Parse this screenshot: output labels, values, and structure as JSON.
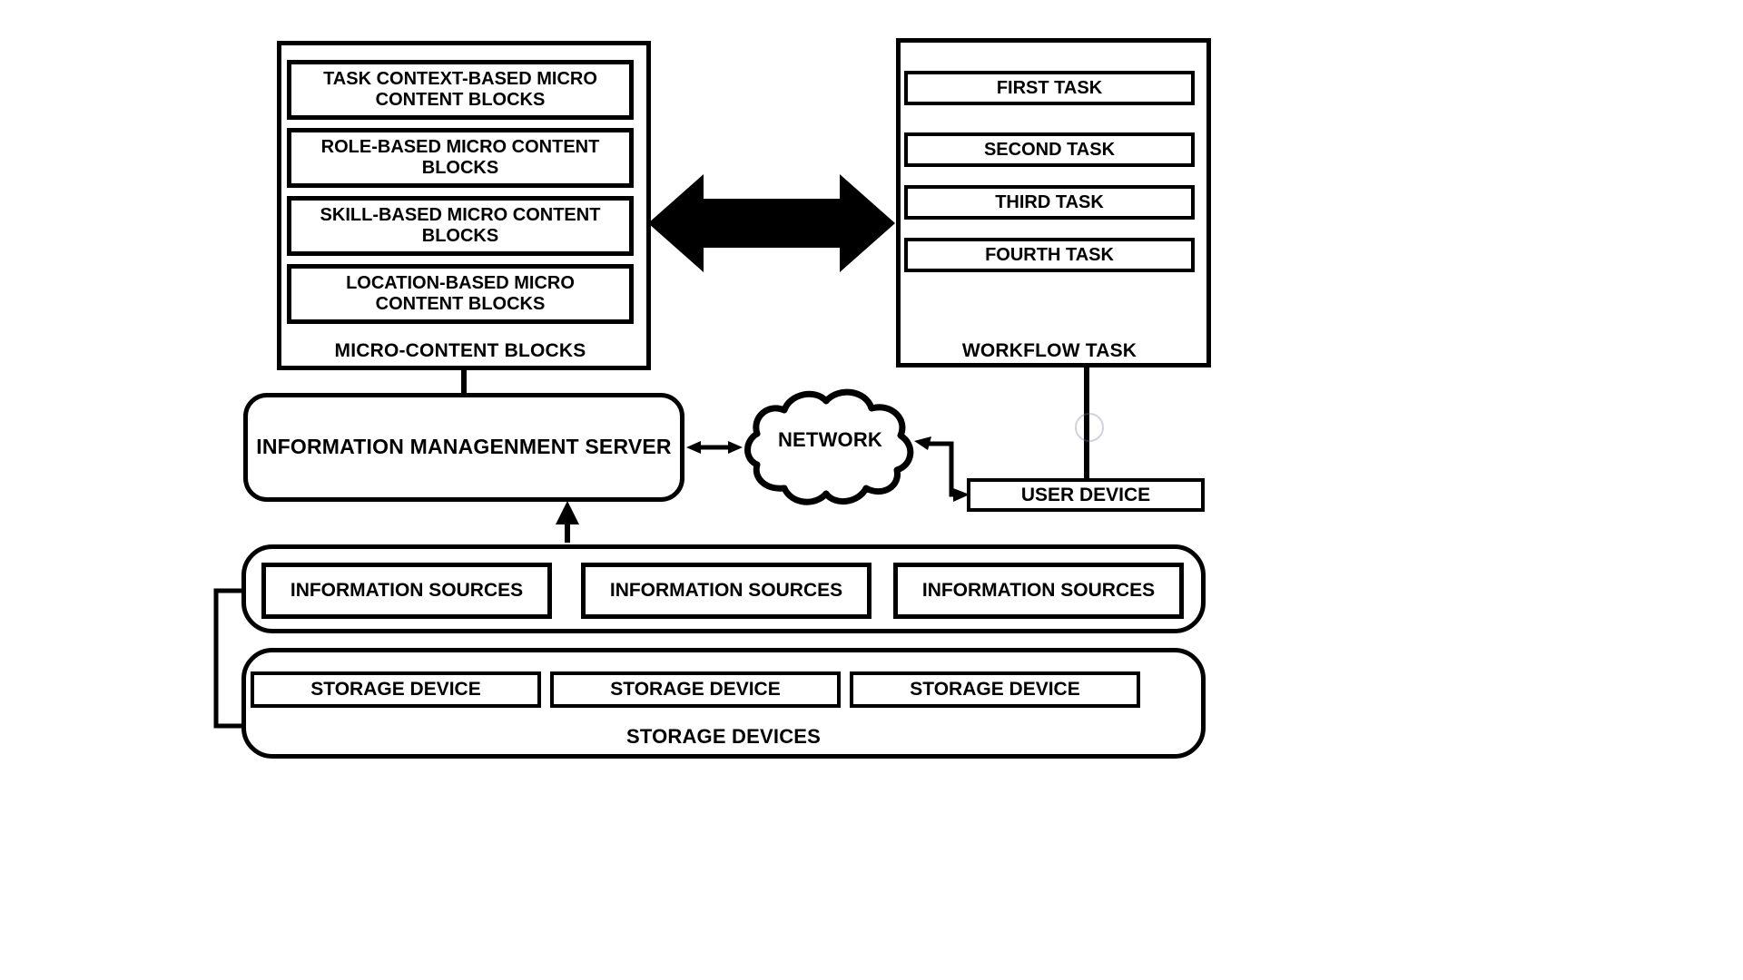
{
  "diagram": {
    "title": "Information management system block diagram",
    "stroke_color": "#000000",
    "background_color": "#ffffff"
  },
  "micro_content_panel": {
    "caption": "MICRO-CONTENT BLOCKS",
    "blocks": [
      {
        "label": "TASK CONTEXT-BASED MICRO CONTENT BLOCKS"
      },
      {
        "label": "ROLE-BASED MICRO CONTENT BLOCKS"
      },
      {
        "label": "SKILL-BASED MICRO CONTENT BLOCKS"
      },
      {
        "label": "LOCATION-BASED MICRO CONTENT BLOCKS"
      }
    ]
  },
  "workflow_panel": {
    "caption": "WORKFLOW TASK",
    "tasks": [
      {
        "label": "FIRST TASK"
      },
      {
        "label": "SECOND TASK"
      },
      {
        "label": "THIRD TASK"
      },
      {
        "label": "FOURTH TASK"
      }
    ]
  },
  "server": {
    "label": "INFORMATION MANAGENMENT SERVER"
  },
  "network": {
    "label": "NETWORK"
  },
  "user_device": {
    "label": "USER DEVICE"
  },
  "information_sources": {
    "items": [
      {
        "label": "INFORMATION SOURCES"
      },
      {
        "label": "INFORMATION SOURCES"
      },
      {
        "label": "INFORMATION SOURCES"
      }
    ]
  },
  "storage_devices": {
    "caption": "STORAGE DEVICES",
    "items": [
      {
        "label": "STORAGE DEVICE"
      },
      {
        "label": "STORAGE DEVICE"
      },
      {
        "label": "STORAGE DEVICE"
      }
    ]
  },
  "connectors": {
    "micro_to_workflow": "bidirectional-block-arrow",
    "micro_to_server": "line",
    "server_to_network": "double-arrow",
    "network_to_user_device": "bent-double-arrow",
    "workflow_to_user_device": "line",
    "sources_to_server": "up-arrow",
    "storage_to_sources": "bracket-line"
  }
}
